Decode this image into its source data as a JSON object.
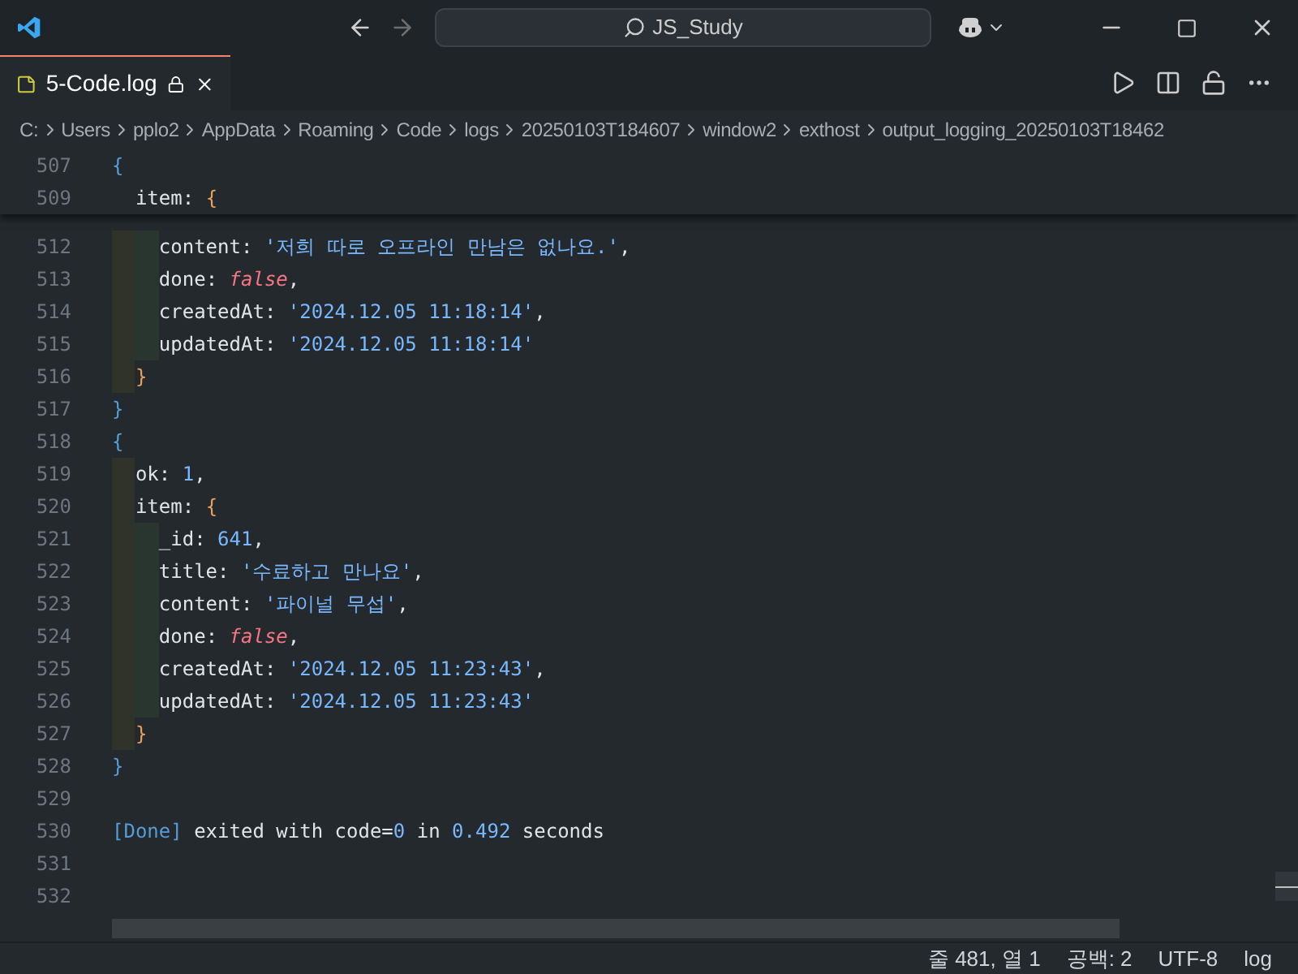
{
  "title_bar": {
    "search": "JS_Study"
  },
  "tab": {
    "label": "5-Code.log",
    "selected": true
  },
  "breadcrumbs": [
    "C:",
    "Users",
    "pplo2",
    "AppData",
    "Roaming",
    "Code",
    "logs",
    "20250103T184607",
    "window2",
    "exthost",
    "output_logging_20250103T18462"
  ],
  "sticky_lines": [
    {
      "number": "507",
      "tokens": [
        {
          "text": "{",
          "kind": "brace"
        }
      ]
    },
    {
      "number": "509",
      "tokens": [
        {
          "text": "  item",
          "kind": "key"
        },
        {
          "text": ": ",
          "kind": "plain"
        },
        {
          "text": "{",
          "kind": "brace2"
        }
      ]
    }
  ],
  "lines": [
    {
      "number": "512",
      "tokens": [
        {
          "text": "    content",
          "kind": "key"
        },
        {
          "text": ": ",
          "kind": "plain"
        },
        {
          "text": "'저희 따로 오프라인 만남은 없나요.'",
          "kind": "string"
        },
        {
          "text": ",",
          "kind": "plain"
        }
      ]
    },
    {
      "number": "513",
      "tokens": [
        {
          "text": "    done",
          "kind": "key"
        },
        {
          "text": ": ",
          "kind": "plain"
        },
        {
          "text": "false",
          "kind": "boolean"
        },
        {
          "text": ",",
          "kind": "plain"
        }
      ]
    },
    {
      "number": "514",
      "tokens": [
        {
          "text": "    createdAt",
          "kind": "key"
        },
        {
          "text": ": ",
          "kind": "plain"
        },
        {
          "text": "'2024.12.05 11:18:14'",
          "kind": "string"
        },
        {
          "text": ",",
          "kind": "plain"
        }
      ]
    },
    {
      "number": "515",
      "tokens": [
        {
          "text": "    updatedAt",
          "kind": "key"
        },
        {
          "text": ": ",
          "kind": "plain"
        },
        {
          "text": "'2024.12.05 11:18:14'",
          "kind": "string"
        }
      ]
    },
    {
      "number": "516",
      "tokens": [
        {
          "text": "  }",
          "kind": "brace2"
        }
      ]
    },
    {
      "number": "517",
      "tokens": [
        {
          "text": "}",
          "kind": "brace"
        }
      ]
    },
    {
      "number": "518",
      "tokens": [
        {
          "text": "{",
          "kind": "brace"
        }
      ]
    },
    {
      "number": "519",
      "tokens": [
        {
          "text": "  ok",
          "kind": "key"
        },
        {
          "text": ": ",
          "kind": "plain"
        },
        {
          "text": "1",
          "kind": "number"
        },
        {
          "text": ",",
          "kind": "plain"
        }
      ]
    },
    {
      "number": "520",
      "tokens": [
        {
          "text": "  item",
          "kind": "key"
        },
        {
          "text": ": ",
          "kind": "plain"
        },
        {
          "text": "{",
          "kind": "brace2"
        }
      ]
    },
    {
      "number": "521",
      "tokens": [
        {
          "text": "    _id",
          "kind": "key"
        },
        {
          "text": ": ",
          "kind": "plain"
        },
        {
          "text": "641",
          "kind": "number"
        },
        {
          "text": ",",
          "kind": "plain"
        }
      ]
    },
    {
      "number": "522",
      "tokens": [
        {
          "text": "    title",
          "kind": "key"
        },
        {
          "text": ": ",
          "kind": "plain"
        },
        {
          "text": "'수료하고 만나요'",
          "kind": "string"
        },
        {
          "text": ",",
          "kind": "plain"
        }
      ]
    },
    {
      "number": "523",
      "tokens": [
        {
          "text": "    content",
          "kind": "key"
        },
        {
          "text": ": ",
          "kind": "plain"
        },
        {
          "text": "'파이널 무섭'",
          "kind": "string"
        },
        {
          "text": ",",
          "kind": "plain"
        }
      ]
    },
    {
      "number": "524",
      "tokens": [
        {
          "text": "    done",
          "kind": "key"
        },
        {
          "text": ": ",
          "kind": "plain"
        },
        {
          "text": "false",
          "kind": "boolean"
        },
        {
          "text": ",",
          "kind": "plain"
        }
      ]
    },
    {
      "number": "525",
      "tokens": [
        {
          "text": "    createdAt",
          "kind": "key"
        },
        {
          "text": ": ",
          "kind": "plain"
        },
        {
          "text": "'2024.12.05 11:23:43'",
          "kind": "string"
        },
        {
          "text": ",",
          "kind": "plain"
        }
      ]
    },
    {
      "number": "526",
      "tokens": [
        {
          "text": "    updatedAt",
          "kind": "key"
        },
        {
          "text": ": ",
          "kind": "plain"
        },
        {
          "text": "'2024.12.05 11:23:43'",
          "kind": "string"
        }
      ]
    },
    {
      "number": "527",
      "tokens": [
        {
          "text": "  }",
          "kind": "brace2"
        }
      ]
    },
    {
      "number": "528",
      "tokens": [
        {
          "text": "}",
          "kind": "brace"
        }
      ]
    },
    {
      "number": "529"
    },
    {
      "number": "530",
      "tokens": [
        {
          "text": "[Done]",
          "kind": "brace"
        },
        {
          "text": " exited with code=",
          "kind": "plain"
        },
        {
          "text": "0",
          "kind": "number"
        },
        {
          "text": " in ",
          "kind": "plain"
        },
        {
          "text": "0.492",
          "kind": "number"
        },
        {
          "text": " seconds",
          "kind": "plain"
        }
      ]
    },
    {
      "number": "531"
    },
    {
      "number": "532"
    }
  ],
  "status_bar": [
    "줄 481, 열 1",
    "공백: 2",
    "UTF-8",
    "log"
  ]
}
